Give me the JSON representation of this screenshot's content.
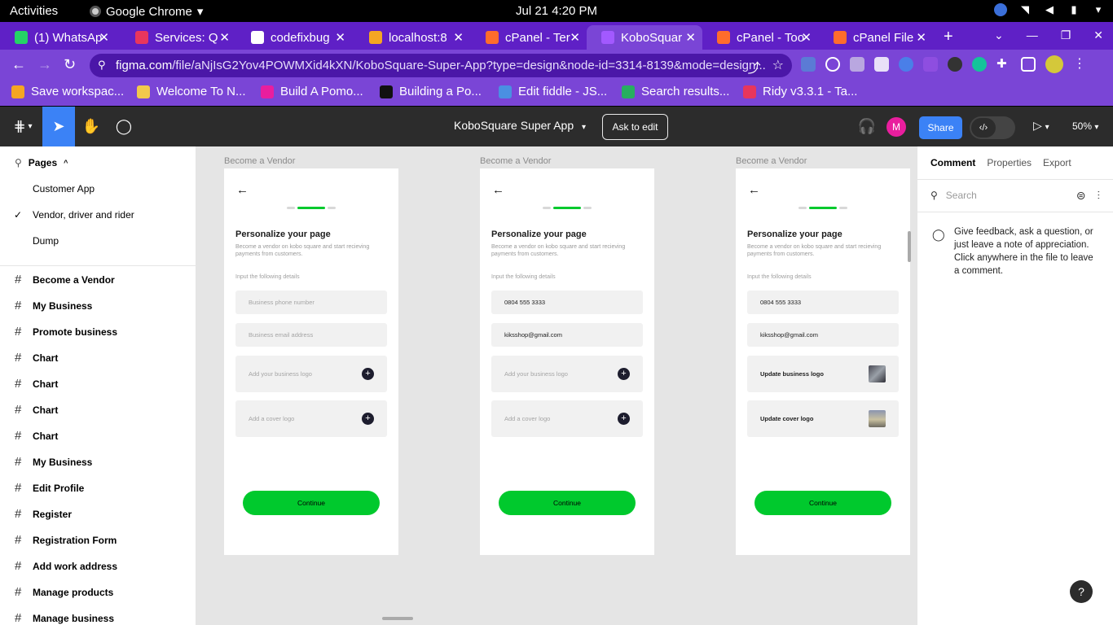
{
  "system": {
    "activities": "Activities",
    "app_name": "Google Chrome",
    "clock": "Jul 21  4:20 PM"
  },
  "tabs": [
    {
      "title": "(1) WhatsAp",
      "icon": "whatsapp-icon",
      "color": "#25d366"
    },
    {
      "title": "Services: Q",
      "icon": "services-icon",
      "color": "#e8365d"
    },
    {
      "title": "codefixbug",
      "icon": "github-icon",
      "color": "#ffffff"
    },
    {
      "title": "localhost:8",
      "icon": "localhost-icon",
      "color": "#f5a623"
    },
    {
      "title": "cPanel - Ter",
      "icon": "cpanel-icon",
      "color": "#ff6c2c"
    },
    {
      "title": "KoboSquar",
      "icon": "figma-icon",
      "color": "#a259ff"
    },
    {
      "title": "cPanel - Too",
      "icon": "cpanel-icon",
      "color": "#ff6c2c"
    },
    {
      "title": "cPanel File",
      "icon": "cpanel-icon",
      "color": "#ff6c2c"
    }
  ],
  "url": {
    "host": "figma.com",
    "path": "/file/aNjIsG2Yov4POWMXid4kXN/KoboSquare-Super-App?type=design&node-id=3314-8139&mode=design..."
  },
  "bookmarks": [
    {
      "label": "Save workspac...",
      "color": "#f5a623"
    },
    {
      "label": "Welcome To N...",
      "color": "#f2c94c"
    },
    {
      "label": "Build A Pomo...",
      "color": "#e91e9e"
    },
    {
      "label": "Building a Po...",
      "color": "#111111"
    },
    {
      "label": "Edit fiddle - JS...",
      "color": "#4a90e2"
    },
    {
      "label": "Search results...",
      "color": "#27ae60"
    },
    {
      "label": "Ridy v3.3.1 - Ta...",
      "color": "#e8365d"
    }
  ],
  "figma": {
    "file_name": "KoboSquare Super App",
    "ask_to_edit": "Ask to edit",
    "avatar_initial": "M",
    "share": "Share",
    "zoom": "50%"
  },
  "left_panel": {
    "pages_header": "Pages",
    "pages": [
      {
        "label": "Customer  App",
        "current": false
      },
      {
        "label": "Vendor, driver and rider",
        "current": true
      },
      {
        "label": "Dump",
        "current": false
      }
    ],
    "frames": [
      "Become a Vendor",
      "My Business",
      "Promote business",
      "Chart",
      "Chart",
      "Chart",
      "Chart",
      "My Business",
      "Edit Profile",
      "Register",
      "Registration Form",
      "Add work address",
      "Manage products",
      "Manage business"
    ]
  },
  "canvas": {
    "frames": [
      {
        "label": "Become a Vendor",
        "title": "Personalize your page",
        "subtitle": "Become a vendor on kobo square and start recieving payments from customers.",
        "section_label": "Input the following details",
        "phone": "Business phone number",
        "phone_filled": false,
        "email": "Business email address",
        "email_filled": false,
        "logo": "Add your business logo",
        "logo_filled": false,
        "cover": "Add a cover logo",
        "cover_filled": false,
        "button": "Continue"
      },
      {
        "label": "Become a Vendor",
        "title": "Personalize your page",
        "subtitle": "Become a vendor on kobo square and start recieving payments from customers.",
        "section_label": "Input the following details",
        "phone": "0804 555 3333",
        "phone_filled": true,
        "email": "kiksshop@gmail.com",
        "email_filled": true,
        "logo": "Add your business logo",
        "logo_filled": false,
        "cover": "Add a cover logo",
        "cover_filled": false,
        "button": "Continue"
      },
      {
        "label": "Become a Vendor",
        "title": "Personalize your page",
        "subtitle": "Become a vendor on kobo square and start recieving payments from customers.",
        "section_label": "Input the following details",
        "phone": "0804 555 3333",
        "phone_filled": true,
        "email": "kiksshop@gmail.com",
        "email_filled": true,
        "logo": "Update business logo",
        "logo_filled": true,
        "cover": "Update cover logo",
        "cover_filled": true,
        "button": "Continue"
      }
    ],
    "accent": "#00c92d"
  },
  "right_panel": {
    "tabs": [
      "Comment",
      "Properties",
      "Export"
    ],
    "search_placeholder": "Search",
    "empty_text": "Give feedback, ask a question, or just leave a note of appreciation. Click anywhere in the file to leave a comment.",
    "help": "?"
  }
}
